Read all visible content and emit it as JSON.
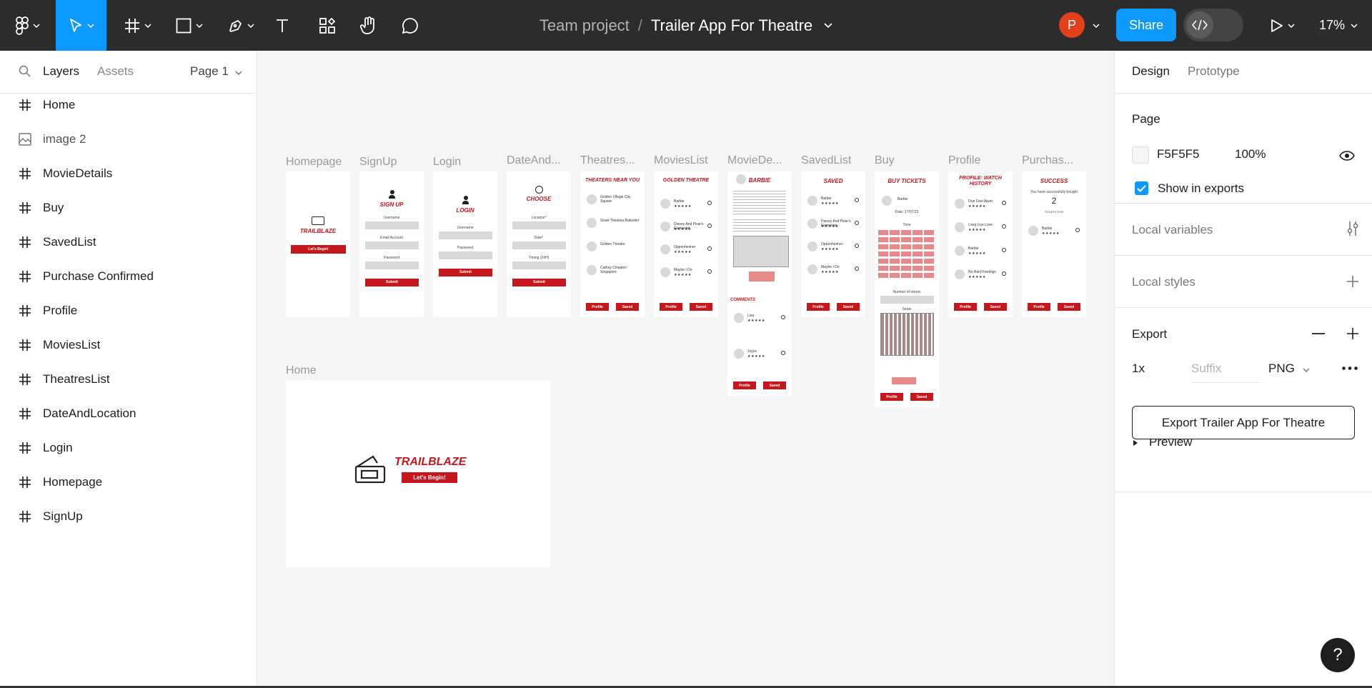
{
  "toolbar": {
    "breadcrumb_team": "Team project",
    "breadcrumb_sep": "/",
    "file_name": "Trailer App For Theatre",
    "avatar_initial": "P",
    "share_label": "Share",
    "zoom": "17%"
  },
  "left_panel": {
    "tab_layers": "Layers",
    "tab_assets": "Assets",
    "page_selector": "Page 1",
    "layers": [
      {
        "name": "Home",
        "icon": "frame-icon"
      },
      {
        "name": "image 2",
        "icon": "image-icon"
      },
      {
        "name": "MovieDetails",
        "icon": "frame-icon"
      },
      {
        "name": "Buy",
        "icon": "frame-icon"
      },
      {
        "name": "SavedList",
        "icon": "frame-icon"
      },
      {
        "name": "Purchase Confirmed",
        "icon": "frame-icon"
      },
      {
        "name": "Profile",
        "icon": "frame-icon"
      },
      {
        "name": "MoviesList",
        "icon": "frame-icon"
      },
      {
        "name": "TheatresList",
        "icon": "frame-icon"
      },
      {
        "name": "DateAndLocation",
        "icon": "frame-icon"
      },
      {
        "name": "Login",
        "icon": "frame-icon"
      },
      {
        "name": "Homepage",
        "icon": "frame-icon"
      },
      {
        "name": "SignUp",
        "icon": "frame-icon"
      }
    ]
  },
  "canvas": {
    "frame_labels": [
      "Homepage",
      "SignUp",
      "Login",
      "DateAnd...",
      "Theatres...",
      "MoviesList",
      "MovieDe...",
      "SavedList",
      "Buy",
      "Profile",
      "Purchas..."
    ],
    "home_label": "Home",
    "brand": "TRAILBLAZE",
    "cta": "Let's Begin!",
    "screen_titles": {
      "signup": "SIGN UP",
      "login": "LOGIN",
      "choose": "CHOOSE",
      "theatres": "THEATERS NEAR YOU",
      "movies": "GOLDEN THEATRE",
      "details": "BARBIE",
      "saved": "SAVED",
      "buy": "BUY TICKETS",
      "profile": "PROFILE: WATCH HISTORY",
      "success": "SUCCESS"
    },
    "mini": {
      "username": "Username",
      "email": "Email Account",
      "password": "Password",
      "submit": "Submit",
      "location": "Location*",
      "date": "Date*",
      "timing": "Timing (24H)",
      "profile_btn": "Profile",
      "saved_btn": "Saved",
      "comments": "COMMENTS",
      "stars": "★★★★★",
      "buy_movie": "Barbie",
      "buy_date": "Date: 27/07/23",
      "buy_time": "Time",
      "tickets_num": "Number of tickets",
      "seats": "Seats",
      "success_msg": "You have successfully bought",
      "success_count": "2",
      "tickets_for": "TICKETS FOR"
    },
    "theatres": [
      "Golden Village City Square",
      "Shaw Theatres Balestier",
      "Golden Theatre",
      "Cathay Cineplex Singapore"
    ],
    "movies": [
      "Barbie",
      "Disney And Pixar's Elemental",
      "Oppenheimer",
      "Maybe I Do"
    ],
    "saved": [
      "Barbie",
      "Disney And Pixar's Elemental",
      "Oppenheimer",
      "Maybe I Do"
    ],
    "history": [
      "Five Feet Apart",
      "Long Live Love",
      "Barbie",
      "No Hard Feelings"
    ],
    "comment_names": [
      "Lisa",
      "Joyce"
    ]
  },
  "right_panel": {
    "tab_design": "Design",
    "tab_prototype": "Prototype",
    "page_heading": "Page",
    "page_color": "F5F5F5",
    "page_opacity": "100%",
    "show_in_exports": "Show in exports",
    "local_variables": "Local variables",
    "local_styles": "Local styles",
    "export_heading": "Export",
    "export_scale": "1x",
    "export_suffix_placeholder": "Suffix",
    "export_format": "PNG",
    "export_button": "Export Trailer App For Theatre",
    "preview": "Preview"
  },
  "colors": {
    "toolbar_bg": "#2c2c2c",
    "accent": "#0d99ff",
    "canvas_bg": "#f5f5f5",
    "brand_red": "#c8161d",
    "avatar": "#e2401b"
  },
  "help": "?"
}
